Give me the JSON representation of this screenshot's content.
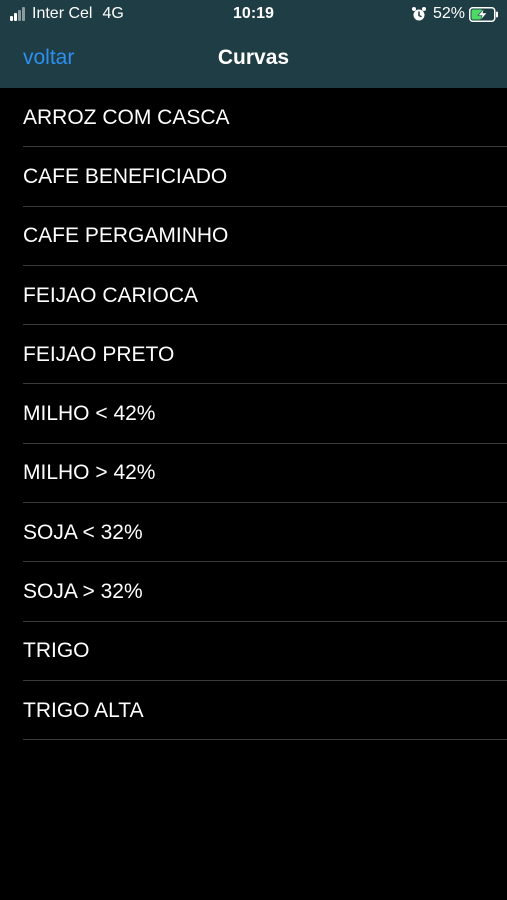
{
  "status_bar": {
    "carrier": "Inter Cel",
    "network": "4G",
    "time": "10:19",
    "battery_percent": "52%",
    "signal_bars_active": 2,
    "signal_bars_total": 4,
    "icons": [
      "signal-icon",
      "alarm-icon",
      "battery-charging-icon"
    ]
  },
  "nav": {
    "back_label": "voltar",
    "title": "Curvas"
  },
  "list": {
    "items": [
      "ARROZ COM CASCA",
      "CAFE BENEFICIADO",
      "CAFE PERGAMINHO",
      "FEIJAO CARIOCA",
      "FEIJAO PRETO",
      "MILHO < 42%",
      "MILHO > 42%",
      "SOJA < 32%",
      "SOJA > 32%",
      "TRIGO",
      "TRIGO ALTA"
    ]
  },
  "colors": {
    "bar_background": "#1e3d44",
    "accent": "#2e8ff0",
    "battery_charge": "#4cd964",
    "separator": "#3a3a3c"
  }
}
